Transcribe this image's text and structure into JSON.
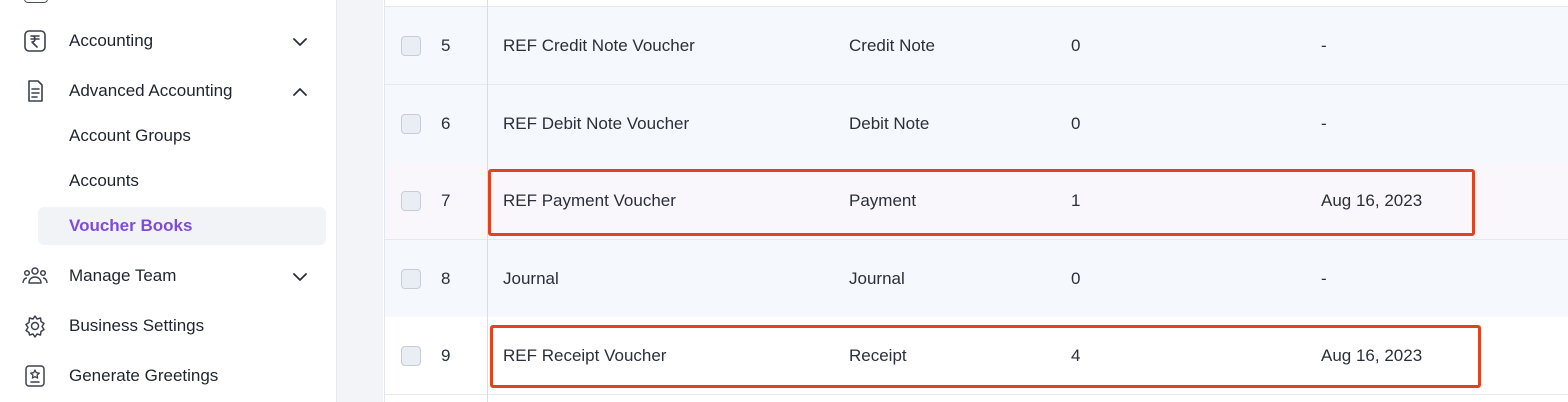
{
  "sidebar": {
    "items": [
      {
        "label": "Accounting",
        "icon": "rupee-icon",
        "chevron": "chevron-down-icon"
      },
      {
        "label": "Advanced Accounting",
        "icon": "document-icon",
        "chevron": "chevron-up-icon"
      },
      {
        "label": "Manage Team",
        "icon": "team-icon",
        "chevron": "chevron-down-icon"
      },
      {
        "label": "Business Settings",
        "icon": "gear-icon"
      },
      {
        "label": "Generate Greetings",
        "icon": "greeting-card-icon"
      }
    ],
    "sub_items": [
      {
        "label": "Account Groups"
      },
      {
        "label": "Accounts"
      },
      {
        "label": "Voucher Books",
        "active": true
      }
    ],
    "active_color": "#7c4ddb"
  },
  "table": {
    "rows": [
      {
        "num": "5",
        "name": "REF Credit Note Voucher",
        "type": "Credit Note",
        "count": "0",
        "date": "-"
      },
      {
        "num": "6",
        "name": "REF Debit Note Voucher",
        "type": "Debit Note",
        "count": "0",
        "date": "-"
      },
      {
        "num": "7",
        "name": "REF Payment Voucher",
        "type": "Payment",
        "count": "1",
        "date": "Aug 16, 2023",
        "highlighted": true
      },
      {
        "num": "8",
        "name": "Journal",
        "type": "Journal",
        "count": "0",
        "date": "-"
      },
      {
        "num": "9",
        "name": "REF Receipt Voucher",
        "type": "Receipt",
        "count": "4",
        "date": "Aug 16, 2023",
        "highlighted": true
      }
    ],
    "highlight_color": "#e4411f"
  }
}
